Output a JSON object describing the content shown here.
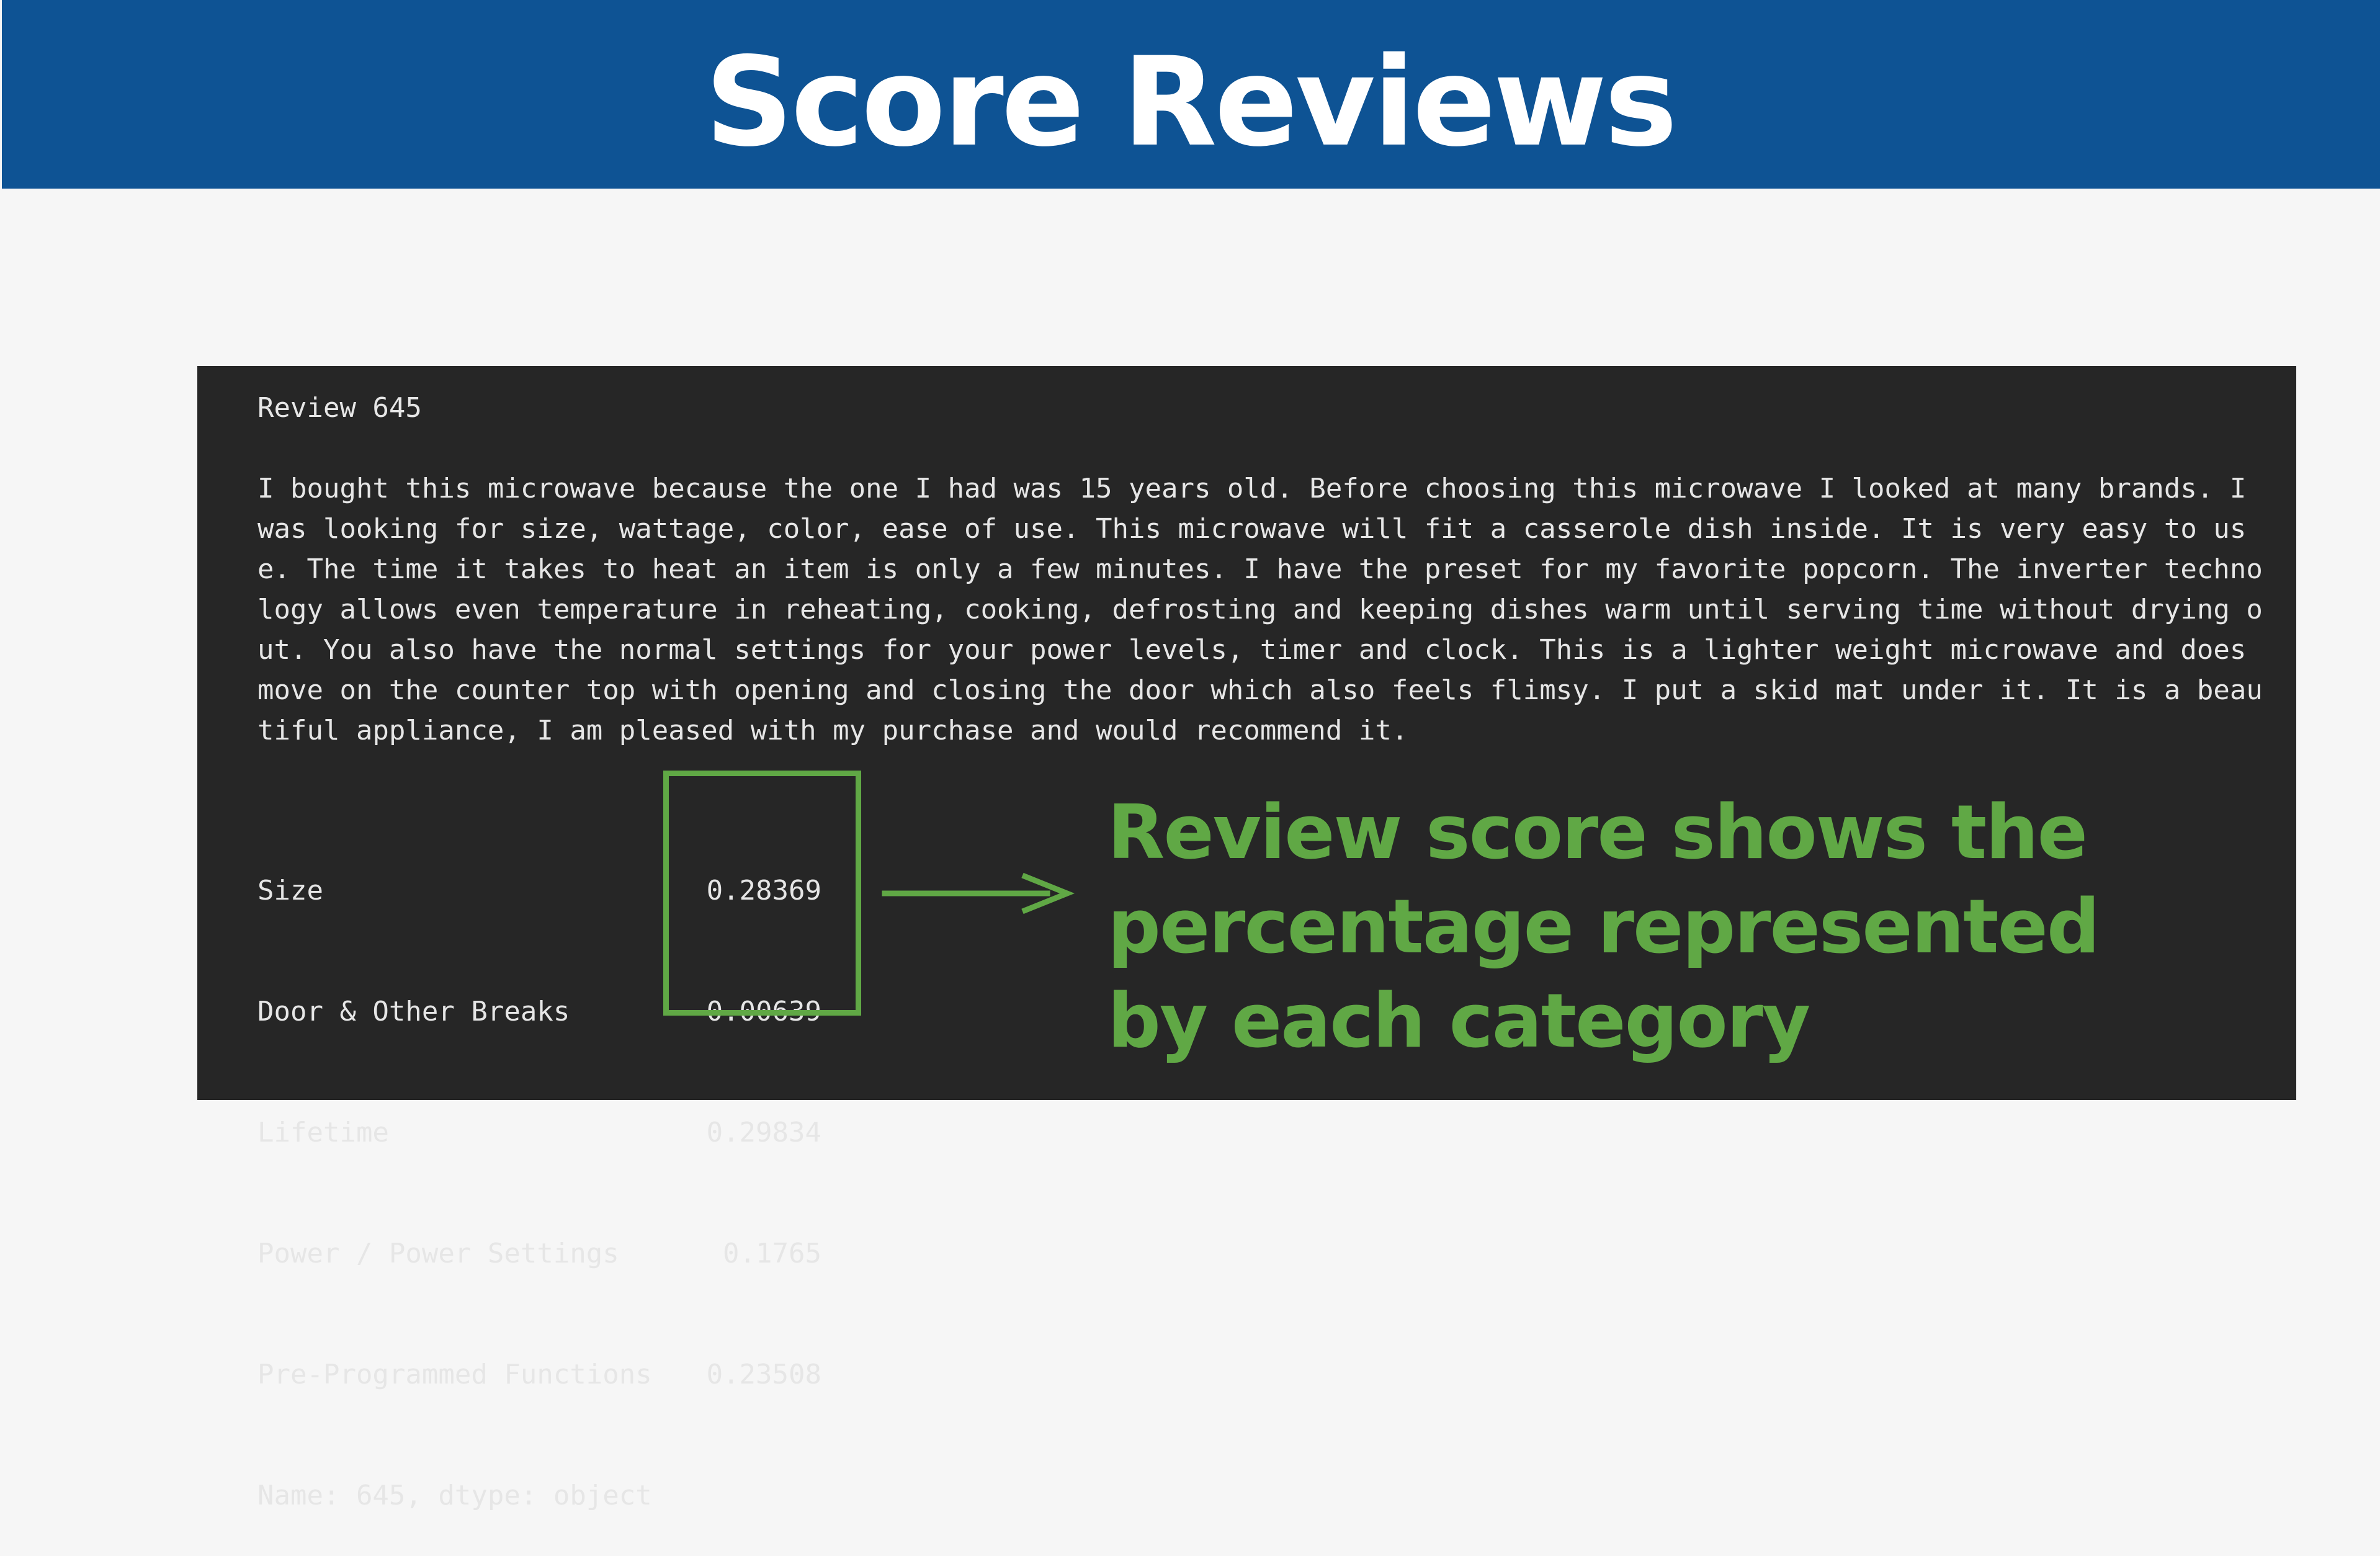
{
  "slide": {
    "title": "Score Reviews",
    "colors": {
      "header": "#0e5394",
      "background": "#f6f6f6",
      "terminal": "#262626",
      "terminal_text": "#e6e6e6",
      "accent": "#60a845"
    }
  },
  "terminal": {
    "review_title": "Review 645",
    "review_text": "I bought this microwave because the one I had was 15 years old.  Before choosing this microwave I looked at many brands.  I was looking for size, wattage, color, ease of use.  This microwave will fit a casserole dish inside.  It is very easy to use.  The time it takes to heat an item is only a few minutes.  I have the preset for my favorite popcorn.  The inverter technology allows even temperature in reheating, cooking, defrosting and  keeping dishes warm until serving time without drying out.  You also have the normal settings for your power levels, timer and clock.  This  is a lighter weight microwave and does move on the counter top with opening and closing the door which also feels flimsy.  I put a skid mat under it.  It is a beautiful appliance,  I am pleased with my purchase and would recommend it.",
    "scores": [
      {
        "label": "Size",
        "value": "0.28369"
      },
      {
        "label": "Door & Other Breaks",
        "value": "0.00639"
      },
      {
        "label": "Lifetime",
        "value": "0.29834"
      },
      {
        "label": "Power / Power Settings",
        "value": "0.1765"
      },
      {
        "label": "Pre-Programmed Functions",
        "value": "0.23508"
      }
    ],
    "footer": "Name: 645, dtype: object"
  },
  "annotation": {
    "lines": [
      "Review score shows the",
      "percentage represented",
      "by each category"
    ]
  },
  "icons": {
    "arrow": "arrow-right-icon"
  }
}
